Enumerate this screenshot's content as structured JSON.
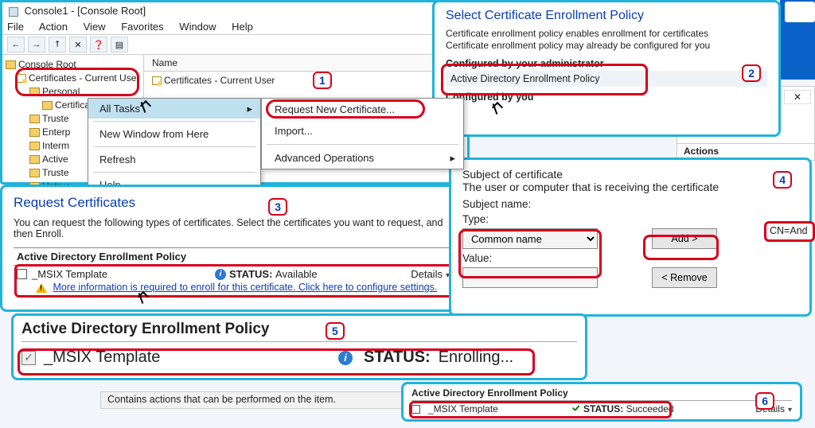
{
  "console": {
    "title": "Console1 - [Console Root]",
    "menus": [
      "File",
      "Action",
      "View",
      "Favorites",
      "Window",
      "Help"
    ],
    "toolbar": [
      "←",
      "→",
      "⭡",
      "✕",
      "❓",
      "▤"
    ],
    "nameCol": "Name",
    "rightCertLabel": "Certificates - Current User",
    "tree": {
      "root": "Console Root",
      "certs": "Certificates - Current User",
      "personal": "Personal",
      "certsFolder": "Certificates",
      "others": [
        "Truste",
        "Enterp",
        "Interm",
        "Active",
        "Truste",
        "Untrus"
      ]
    },
    "ctx1": {
      "alltasks": "All Tasks",
      "newwin": "New Window from Here",
      "refresh": "Refresh",
      "help": "Help"
    },
    "ctx2": {
      "reqnew": "Request New Certificate...",
      "import": "Import...",
      "advops": "Advanced Operations"
    }
  },
  "enrollPolicy": {
    "title": "Select Certificate Enrollment Policy",
    "desc1": "Certificate enrollment policy enables enrollment for certificates",
    "desc2": "Certificate enrollment policy may already be configured for you",
    "secAdmin": "Configured by your administrator",
    "adep": "Active Directory Enrollment Policy",
    "secYou": "Configured by you"
  },
  "winbuttons": {
    "min": "—",
    "max": "☐",
    "close": "✕"
  },
  "actions": {
    "header": "Actions"
  },
  "reqCerts": {
    "title": "Request Certificates",
    "desc": "You can request the following types of certificates. Select the certificates you want to request, and then Enroll.",
    "policy": "Active Directory Enrollment Policy",
    "template": "_MSIX Template",
    "statusL": "STATUS:",
    "statusV": "Available",
    "details": "Details",
    "warn": "More information is required to enroll for this certificate. Click here to configure settings."
  },
  "subject": {
    "t1": "Subject of certificate",
    "t2": "The user or computer that is receiving the certificate",
    "subjName": "Subject name:",
    "typeL": "Type:",
    "typeV": "Common name",
    "valueL": "Value:",
    "valueV": "",
    "add": "Add >",
    "remove": "< Remove",
    "cnchip": "CN=And"
  },
  "enrolling": {
    "policy": "Active Directory Enrollment Policy",
    "template": "_MSIX Template",
    "statusL": "STATUS:",
    "statusV": "Enrolling..."
  },
  "statusbar": "Contains actions that can be performed on the item.",
  "succeeded": {
    "policy": "Active Directory Enrollment Policy",
    "template": "_MSIX Template",
    "statusL": "STATUS:",
    "statusV": "Succeeded",
    "details": "Details"
  },
  "markers": {
    "m1": "1",
    "m2": "2",
    "m3": "3",
    "m4": "4",
    "m5": "5",
    "m6": "6"
  }
}
